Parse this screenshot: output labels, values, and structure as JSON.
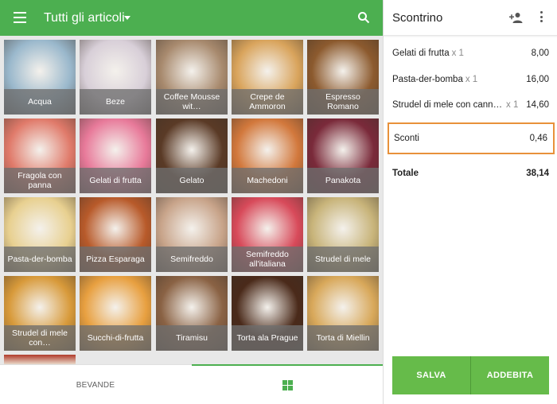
{
  "header": {
    "title": "Tutti gli articoli",
    "menu_icon": "menu-icon",
    "dropdown_icon": "caret-down-icon",
    "search_icon": "search-icon"
  },
  "products": [
    {
      "label": "Acqua",
      "color": "#9ab8cc"
    },
    {
      "label": "Beze",
      "color": "#d8cfd8"
    },
    {
      "label": "Coffee Mousse wit…",
      "color": "#a88a6e"
    },
    {
      "label": "Crepe de Ammoron",
      "color": "#d9a45c"
    },
    {
      "label": "Espresso Romano",
      "color": "#8c5a2e"
    },
    {
      "label": "Fragola con panna",
      "color": "#e07a6a"
    },
    {
      "label": "Gelati di frutta",
      "color": "#e87a9a"
    },
    {
      "label": "Gelato",
      "color": "#5a3a26"
    },
    {
      "label": "Machedoni",
      "color": "#d2783c"
    },
    {
      "label": "Panakota",
      "color": "#7a2a3a"
    },
    {
      "label": "Pasta-der-bomba",
      "color": "#e8d090"
    },
    {
      "label": "Pizza Esparaga",
      "color": "#b85a2a"
    },
    {
      "label": "Semifreddo",
      "color": "#c8a48a"
    },
    {
      "label": "Semifreddo all'italiana",
      "color": "#d84a5a"
    },
    {
      "label": "Strudel di mele",
      "color": "#c8b47a"
    },
    {
      "label": "Strudel di mele con…",
      "color": "#d89a3a"
    },
    {
      "label": "Succhi-di-frutta",
      "color": "#e8a040"
    },
    {
      "label": "Tiramisu",
      "color": "#8a6244"
    },
    {
      "label": "Torta ala Prague",
      "color": "#4a2a1a"
    },
    {
      "label": "Torta di Miellin",
      "color": "#d8a85a"
    }
  ],
  "bottom_nav": {
    "tab_bevande": "BEVANDE",
    "grid_icon": "grid-icon"
  },
  "receipt": {
    "title": "Scontrino",
    "add_customer_icon": "add-user-icon",
    "more_icon": "more-vert-icon",
    "lines": [
      {
        "name": "Gelati di frutta",
        "qty": "x 1",
        "amount": "8,00"
      },
      {
        "name": "Pasta-der-bomba",
        "qty": "x 1",
        "amount": "16,00"
      },
      {
        "name": "Strudel di mele con cannella",
        "qty": "x 1",
        "amount": "14,60"
      }
    ],
    "discount": {
      "label": "Sconti",
      "amount": "0,46"
    },
    "total": {
      "label": "Totale",
      "amount": "38,14"
    },
    "save_label": "SALVA",
    "charge_label": "ADDEBITA"
  },
  "colors": {
    "accent": "#4caf50",
    "button": "#66bb4a",
    "highlight": "#e8913a"
  }
}
